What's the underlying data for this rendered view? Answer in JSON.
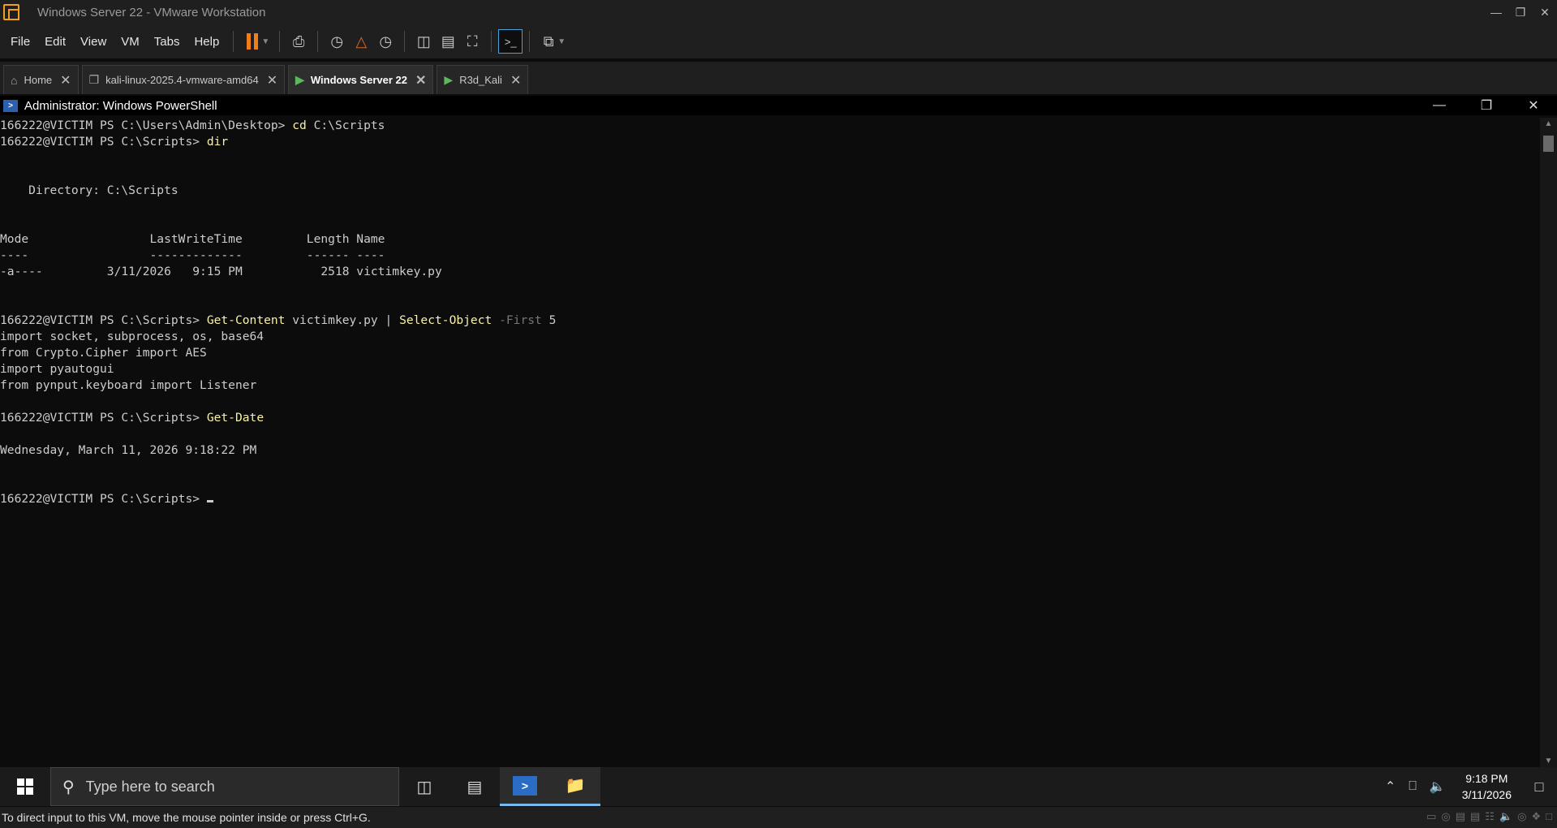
{
  "vmware": {
    "window_title": "Windows Server 22 - VMware Workstation",
    "menu": [
      "File",
      "Edit",
      "View",
      "VM",
      "Tabs",
      "Help"
    ]
  },
  "tabs": [
    {
      "label": "Home",
      "icon": "home-icon"
    },
    {
      "label": "kali-linux-2025.4-vmware-amd64",
      "icon": "vm-icon"
    },
    {
      "label": "Windows Server 22",
      "icon": "vm-running-icon",
      "active": true
    },
    {
      "label": "R3d_Kali",
      "icon": "vm-running-icon"
    }
  ],
  "powershell": {
    "title": "Administrator: Windows PowerShell"
  },
  "console": {
    "l1_prompt": "166222@VICTIM PS C:\\Users\\Admin\\Desktop> ",
    "l1_cmd": "cd",
    "l1_args": " C:\\Scripts",
    "l2_prompt": "166222@VICTIM PS C:\\Scripts> ",
    "l2_cmd": "dir",
    "dir_header": "    Directory: C:\\Scripts",
    "col_header": "Mode                 LastWriteTime         Length Name",
    "col_underline": "----                 -------------         ------ ----",
    "file_row": "-a----         3/11/2026   9:15 PM           2518 victimkey.py",
    "l3_prompt": "166222@VICTIM PS C:\\Scripts> ",
    "l3_cmd": "Get-Content",
    "l3_arg": " victimkey.py | ",
    "l3_cmd2": "Select-Object",
    "l3_param": " -First",
    "l3_val": " 5",
    "out1": "import socket, subprocess, os, base64",
    "out2": "from Crypto.Cipher import AES",
    "out3": "import pyautogui",
    "out4": "from pynput.keyboard import Listener",
    "l4_prompt": "166222@VICTIM PS C:\\Scripts> ",
    "l4_cmd": "Get-Date",
    "date_out": "Wednesday, March 11, 2026 9:18:22 PM",
    "l5_prompt": "166222@VICTIM PS C:\\Scripts> "
  },
  "taskbar": {
    "search_placeholder": "Type here to search",
    "time": "9:18 PM",
    "date": "3/11/2026"
  },
  "statusbar": {
    "text": "To direct input to this VM, move the mouse pointer inside or press Ctrl+G."
  }
}
